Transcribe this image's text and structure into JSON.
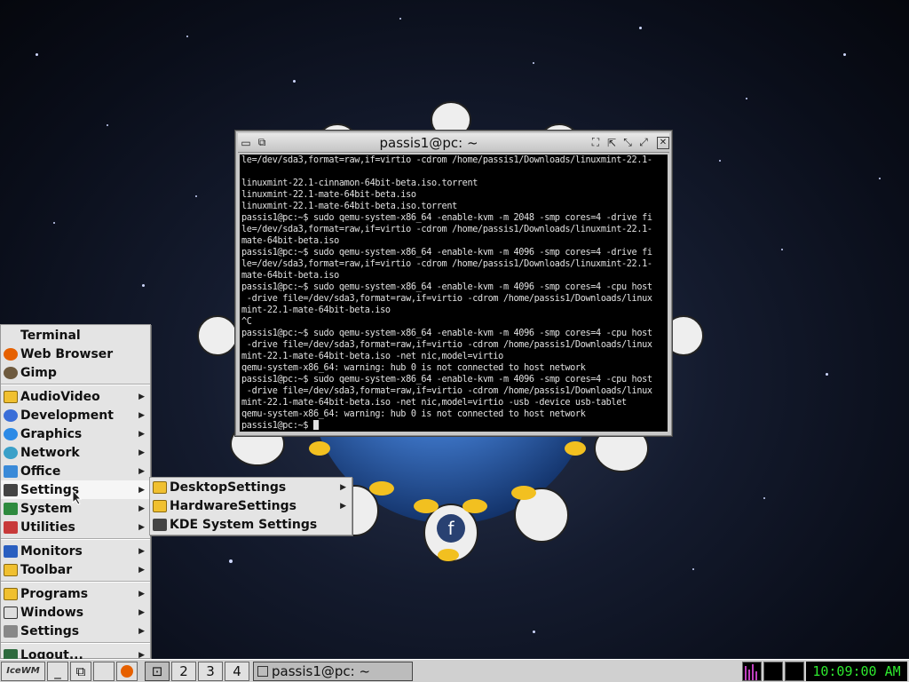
{
  "terminal": {
    "title": "passis1@pc: ~",
    "lines": [
      "le=/dev/sda3,format=raw,if=virtio -cdrom /home/passis1/Downloads/linuxmint-22.1-",
      "",
      "linuxmint-22.1-cinnamon-64bit-beta.iso.torrent",
      "linuxmint-22.1-mate-64bit-beta.iso",
      "linuxmint-22.1-mate-64bit-beta.iso.torrent",
      "passis1@pc:~$ sudo qemu-system-x86_64 -enable-kvm -m 2048 -smp cores=4 -drive fi",
      "le=/dev/sda3,format=raw,if=virtio -cdrom /home/passis1/Downloads/linuxmint-22.1-",
      "mate-64bit-beta.iso",
      "passis1@pc:~$ sudo qemu-system-x86_64 -enable-kvm -m 4096 -smp cores=4 -drive fi",
      "le=/dev/sda3,format=raw,if=virtio -cdrom /home/passis1/Downloads/linuxmint-22.1-",
      "mate-64bit-beta.iso",
      "passis1@pc:~$ sudo qemu-system-x86_64 -enable-kvm -m 4096 -smp cores=4 -cpu host",
      " -drive file=/dev/sda3,format=raw,if=virtio -cdrom /home/passis1/Downloads/linux",
      "mint-22.1-mate-64bit-beta.iso",
      "^C",
      "passis1@pc:~$ sudo qemu-system-x86_64 -enable-kvm -m 4096 -smp cores=4 -cpu host",
      " -drive file=/dev/sda3,format=raw,if=virtio -cdrom /home/passis1/Downloads/linux",
      "mint-22.1-mate-64bit-beta.iso -net nic,model=virtio",
      "qemu-system-x86_64: warning: hub 0 is not connected to host network",
      "passis1@pc:~$ sudo qemu-system-x86_64 -enable-kvm -m 4096 -smp cores=4 -cpu host",
      " -drive file=/dev/sda3,format=raw,if=virtio -cdrom /home/passis1/Downloads/linux",
      "mint-22.1-mate-64bit-beta.iso -net nic,model=virtio -usb -device usb-tablet",
      "qemu-system-x86_64: warning: hub 0 is not connected to host network"
    ],
    "prompt": "passis1@pc:~$ "
  },
  "menu": {
    "items": [
      {
        "label": "Terminal",
        "icon": "terminal-icon",
        "color": "#333333"
      },
      {
        "label": "Web Browser",
        "icon": "firefox-icon",
        "color": "#e66000"
      },
      {
        "label": "Gimp",
        "icon": "gimp-icon",
        "color": "#6e5a3e"
      }
    ],
    "categories": [
      {
        "label": "AudioVideo",
        "icon": "folder-icon"
      },
      {
        "label": "Development",
        "icon": "development-icon"
      },
      {
        "label": "Graphics",
        "icon": "graphics-icon"
      },
      {
        "label": "Network",
        "icon": "network-icon"
      },
      {
        "label": "Office",
        "icon": "office-icon"
      },
      {
        "label": "Settings",
        "icon": "settings-icon"
      },
      {
        "label": "System",
        "icon": "system-icon"
      },
      {
        "label": "Utilities",
        "icon": "utilities-icon"
      }
    ],
    "extras": [
      {
        "label": "Monitors",
        "icon": "monitor-icon"
      },
      {
        "label": "Toolbar",
        "icon": "folder-icon"
      }
    ],
    "wm": [
      {
        "label": "Programs",
        "icon": "programs-icon"
      },
      {
        "label": "Windows",
        "icon": "windows-icon"
      },
      {
        "label": "Settings",
        "icon": "wrench-icon"
      }
    ],
    "logout": {
      "label": "Logout...",
      "icon": "logout-icon"
    }
  },
  "submenu": {
    "items": [
      {
        "label": "DesktopSettings",
        "icon": "folder-icon",
        "has_arrow": true
      },
      {
        "label": "HardwareSettings",
        "icon": "folder-icon",
        "has_arrow": true
      },
      {
        "label": "KDE System Settings",
        "icon": "kde-settings-icon",
        "has_arrow": false
      }
    ]
  },
  "taskbar": {
    "workspaces": [
      "2",
      "3",
      "4"
    ],
    "task_label": "passis1@pc: ~",
    "clock": "10:09:00 AM"
  }
}
